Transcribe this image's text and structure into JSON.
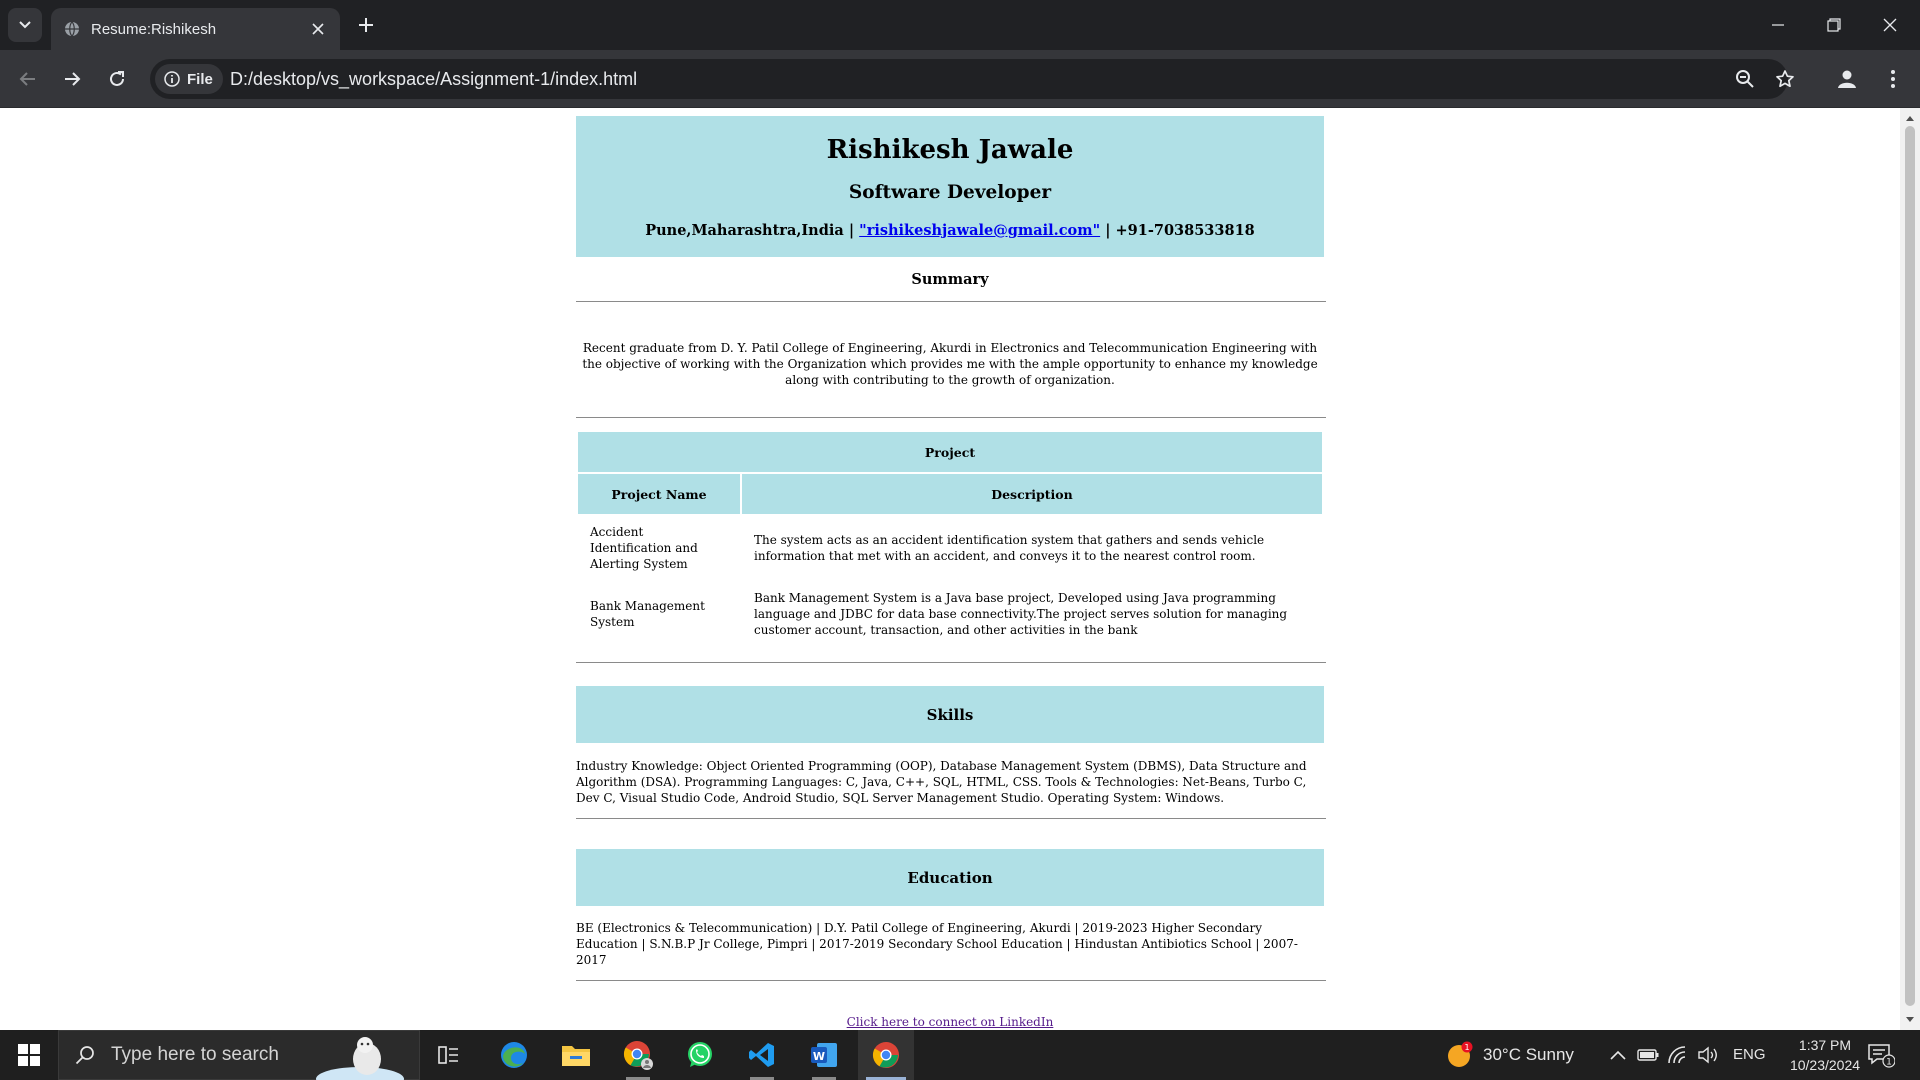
{
  "browser": {
    "tab_title": "Resume:Rishikesh",
    "chip_label": "File",
    "url": "D:/desktop/vs_workspace/Assignment-1/index.html"
  },
  "resume": {
    "name": "Rishikesh Jawale",
    "role": "Software Developer",
    "location": "Pune,Maharashtra,India",
    "separator": " | ",
    "email": "\"rishikeshjawale@gmail.com\"",
    "phone": "+91-7038533818",
    "summary_title": "Summary",
    "summary_text": "Recent graduate from D. Y. Patil College of Engineering, Akurdi in Electronics and Telecommunication Engineering with the objective of working with the Organization which provides me with the ample opportunity to enhance my knowledge along with contributing to the growth of organization.",
    "project": {
      "title": "Project",
      "col_name": "Project Name",
      "col_desc": "Description",
      "rows": [
        {
          "name": "Accident Identification and Alerting System",
          "desc": "The system acts as an accident identification system that gathers and sends vehicle information that met with an accident, and conveys it to the nearest control room."
        },
        {
          "name": "Bank Management System",
          "desc": "Bank Management System is a Java base project, Developed using Java programming language and JDBC for data base connectivity.The project serves solution for managing customer account, transaction, and other activities in the bank"
        }
      ]
    },
    "skills_title": "Skills",
    "skills_text": "Industry Knowledge: Object Oriented Programming (OOP), Database Management System (DBMS), Data Structure and Algorithm (DSA). Programming Languages: C, Java, C++, SQL, HTML, CSS. Tools & Technologies: Net-Beans, Turbo C, Dev C, Visual Studio Code, Android Studio, SQL Server Management Studio. Operating System: Windows.",
    "education_title": "Education",
    "education_text": "BE (Electronics & Telecommunication) | D.Y. Patil College of Engineering, Akurdi | 2019-2023 Higher Secondary Education | S.N.B.P Jr College, Pimpri | 2017-2019 Secondary School Education | Hindustan Antibiotics School | 2007-2017",
    "linkedin_text": "Click here to connect on LinkedIn"
  },
  "taskbar": {
    "search_placeholder": "Type here to search",
    "weather": "30°C  Sunny",
    "weather_badge": "1",
    "language": "ENG",
    "time": "1:37 PM",
    "date": "10/23/2024",
    "notification_count": "1"
  },
  "icons": {
    "tab_favicon": "globe-icon",
    "info": "info-icon",
    "zoom": "zoom-icon",
    "bookmark": "star-icon",
    "profile": "profile-icon",
    "menu": "kebab-menu-icon",
    "apps": [
      "task-view-icon",
      "edge-icon",
      "file-explorer-icon",
      "chrome-profile-icon",
      "whatsapp-icon",
      "vscode-icon",
      "word-icon",
      "chrome-icon"
    ]
  },
  "colors": {
    "header_bg": "#b0e0e6",
    "link": "#0000ee",
    "visited_link": "#551a8b",
    "browser_dark": "#202124"
  }
}
